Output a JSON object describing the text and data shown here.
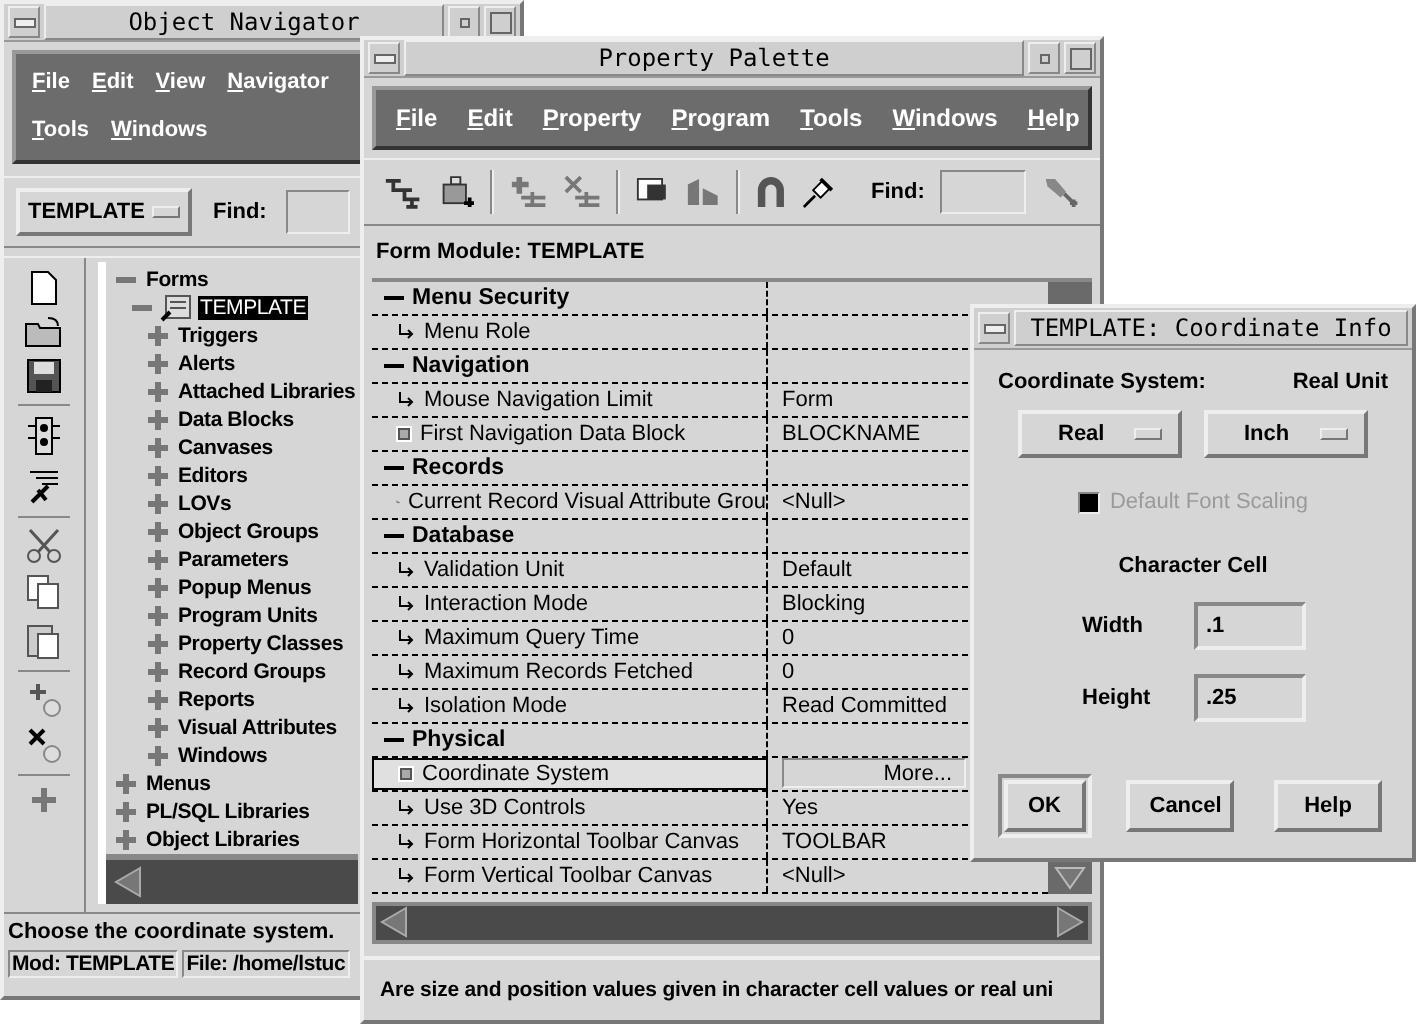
{
  "navigator": {
    "title": "Object Navigator",
    "menu_rows": [
      [
        "File",
        "Edit",
        "View",
        "Navigator"
      ],
      [
        "Tools",
        "Windows"
      ]
    ],
    "module_dropdown": "TEMPLATE",
    "find_label": "Find:",
    "tree": [
      {
        "label": "Forms",
        "expanded": true,
        "selected": false,
        "children": [
          {
            "label": "TEMPLATE",
            "expanded": true,
            "selected": true,
            "children": [
              {
                "label": "Triggers",
                "expanded": false,
                "selected": false
              },
              {
                "label": "Alerts",
                "expanded": false,
                "selected": false
              },
              {
                "label": "Attached Libraries",
                "expanded": false,
                "selected": false
              },
              {
                "label": "Data Blocks",
                "expanded": false,
                "selected": false
              },
              {
                "label": "Canvases",
                "expanded": false,
                "selected": false
              },
              {
                "label": "Editors",
                "expanded": false,
                "selected": false
              },
              {
                "label": "LOVs",
                "expanded": false,
                "selected": false
              },
              {
                "label": "Object Groups",
                "expanded": false,
                "selected": false
              },
              {
                "label": "Parameters",
                "expanded": false,
                "selected": false
              },
              {
                "label": "Popup Menus",
                "expanded": false,
                "selected": false
              },
              {
                "label": "Program Units",
                "expanded": false,
                "selected": false
              },
              {
                "label": "Property Classes",
                "expanded": false,
                "selected": false
              },
              {
                "label": "Record Groups",
                "expanded": false,
                "selected": false
              },
              {
                "label": "Reports",
                "expanded": false,
                "selected": false
              },
              {
                "label": "Visual Attributes",
                "expanded": false,
                "selected": false
              },
              {
                "label": "Windows",
                "expanded": false,
                "selected": false
              }
            ]
          }
        ]
      },
      {
        "label": "Menus",
        "expanded": false,
        "selected": false
      },
      {
        "label": "PL/SQL Libraries",
        "expanded": false,
        "selected": false
      },
      {
        "label": "Object Libraries",
        "expanded": false,
        "selected": false
      }
    ],
    "status": "Choose the coordinate system.",
    "status_fields": [
      "Mod: TEMPLATE",
      "File: /home/lstuc"
    ]
  },
  "palette": {
    "title": "Property Palette",
    "menu": [
      "File",
      "Edit",
      "Property",
      "Program",
      "Tools",
      "Windows",
      "Help"
    ],
    "find_label": "Find:",
    "context": "Form Module: TEMPLATE",
    "rows": [
      {
        "kind": "group",
        "name": "Menu Security",
        "expanded": true
      },
      {
        "kind": "property",
        "name": "Menu Role",
        "changed": false,
        "selected": false
      },
      {
        "kind": "group",
        "name": "Navigation",
        "expanded": true
      },
      {
        "kind": "property",
        "name": "Mouse Navigation Limit",
        "changed": false,
        "selected": false,
        "value": "Form"
      },
      {
        "kind": "property",
        "name": "First Navigation Data Block",
        "changed": true,
        "selected": false,
        "value": "BLOCKNAME"
      },
      {
        "kind": "group",
        "name": "Records",
        "expanded": true
      },
      {
        "kind": "property",
        "name": "Current Record Visual Attribute Grou",
        "changed": false,
        "selected": false,
        "value": "<Null>"
      },
      {
        "kind": "group",
        "name": "Database",
        "expanded": true
      },
      {
        "kind": "property",
        "name": "Validation Unit",
        "changed": false,
        "selected": false,
        "value": "Default"
      },
      {
        "kind": "property",
        "name": "Interaction Mode",
        "changed": false,
        "selected": false,
        "value": "Blocking"
      },
      {
        "kind": "property",
        "name": "Maximum Query Time",
        "changed": false,
        "selected": false,
        "value": "0"
      },
      {
        "kind": "property",
        "name": "Maximum Records Fetched",
        "changed": false,
        "selected": false,
        "value": "0"
      },
      {
        "kind": "property",
        "name": "Isolation Mode",
        "changed": false,
        "selected": false,
        "value": "Read Committed"
      },
      {
        "kind": "group",
        "name": "Physical",
        "expanded": true
      },
      {
        "kind": "action",
        "name": "Coordinate System",
        "changed": true,
        "selected": true,
        "value": "More..."
      },
      {
        "kind": "property",
        "name": "Use 3D Controls",
        "changed": false,
        "selected": false,
        "value": "Yes"
      },
      {
        "kind": "property",
        "name": "Form Horizontal Toolbar Canvas",
        "changed": false,
        "selected": false,
        "value": "TOOLBAR"
      },
      {
        "kind": "property",
        "name": "Form Vertical Toolbar Canvas",
        "changed": false,
        "selected": false,
        "value": "<Null>"
      }
    ],
    "status": "Are size and position values given in character cell values or real uni"
  },
  "dialog": {
    "title": "TEMPLATE: Coordinate Info",
    "coordinate_label": "Coordinate System:",
    "unit_label": "Real Unit",
    "coordinate_value": "Real",
    "unit_value": "Inch",
    "checkbox": {
      "label": "Default Font Scaling",
      "checked": true,
      "disabled": true
    },
    "cell_heading": "Character Cell",
    "fields": [
      {
        "label": "Width",
        "value": ".1"
      },
      {
        "label": "Height",
        "value": ".25"
      }
    ],
    "buttons": [
      {
        "label": "OK",
        "default": true
      },
      {
        "label": "Cancel",
        "default": false
      },
      {
        "label": "Help",
        "default": false
      }
    ]
  }
}
